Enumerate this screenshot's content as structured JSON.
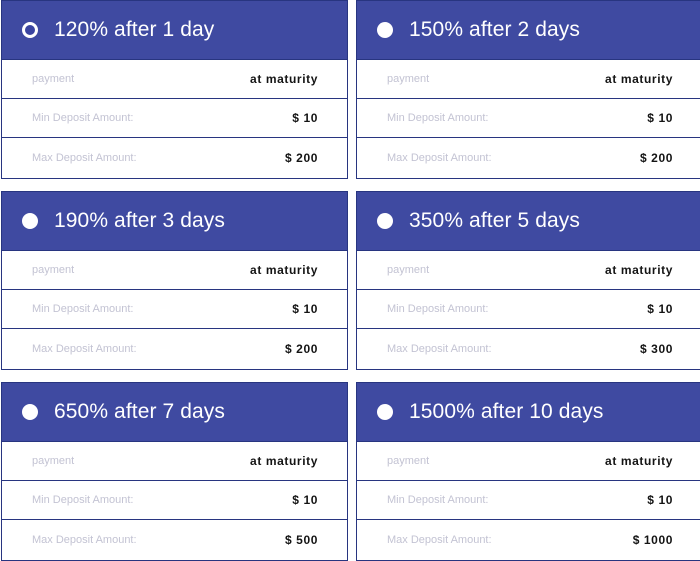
{
  "colors": {
    "header_bg": "#3f4aa1",
    "border": "#283580",
    "label": "#c3c3d3",
    "value": "#141414"
  },
  "plans": [
    {
      "title": "120% after 1 day",
      "selected": true,
      "rows": [
        {
          "label": "payment",
          "value": "at maturity"
        },
        {
          "label": "Min Deposit Amount:",
          "value": "$ 10"
        },
        {
          "label": "Max Deposit Amount:",
          "value": "$ 200"
        }
      ]
    },
    {
      "title": "150% after 2 days",
      "selected": false,
      "rows": [
        {
          "label": "payment",
          "value": "at maturity"
        },
        {
          "label": "Min Deposit Amount:",
          "value": "$ 10"
        },
        {
          "label": "Max Deposit Amount:",
          "value": "$ 200"
        }
      ]
    },
    {
      "title": "190% after 3 days",
      "selected": false,
      "rows": [
        {
          "label": "payment",
          "value": "at maturity"
        },
        {
          "label": "Min Deposit Amount:",
          "value": "$ 10"
        },
        {
          "label": "Max Deposit Amount:",
          "value": "$ 200"
        }
      ]
    },
    {
      "title": "350% after 5 days",
      "selected": false,
      "rows": [
        {
          "label": "payment",
          "value": "at maturity"
        },
        {
          "label": "Min Deposit Amount:",
          "value": "$ 10"
        },
        {
          "label": "Max Deposit Amount:",
          "value": "$ 300"
        }
      ]
    },
    {
      "title": "650% after 7 days",
      "selected": false,
      "rows": [
        {
          "label": "payment",
          "value": "at maturity"
        },
        {
          "label": "Min Deposit Amount:",
          "value": "$ 10"
        },
        {
          "label": "Max Deposit Amount:",
          "value": "$ 500"
        }
      ]
    },
    {
      "title": "1500% after 10 days",
      "selected": false,
      "rows": [
        {
          "label": "payment",
          "value": "at maturity"
        },
        {
          "label": "Min Deposit Amount:",
          "value": "$ 10"
        },
        {
          "label": "Max Deposit Amount:",
          "value": "$ 1000"
        }
      ]
    }
  ]
}
